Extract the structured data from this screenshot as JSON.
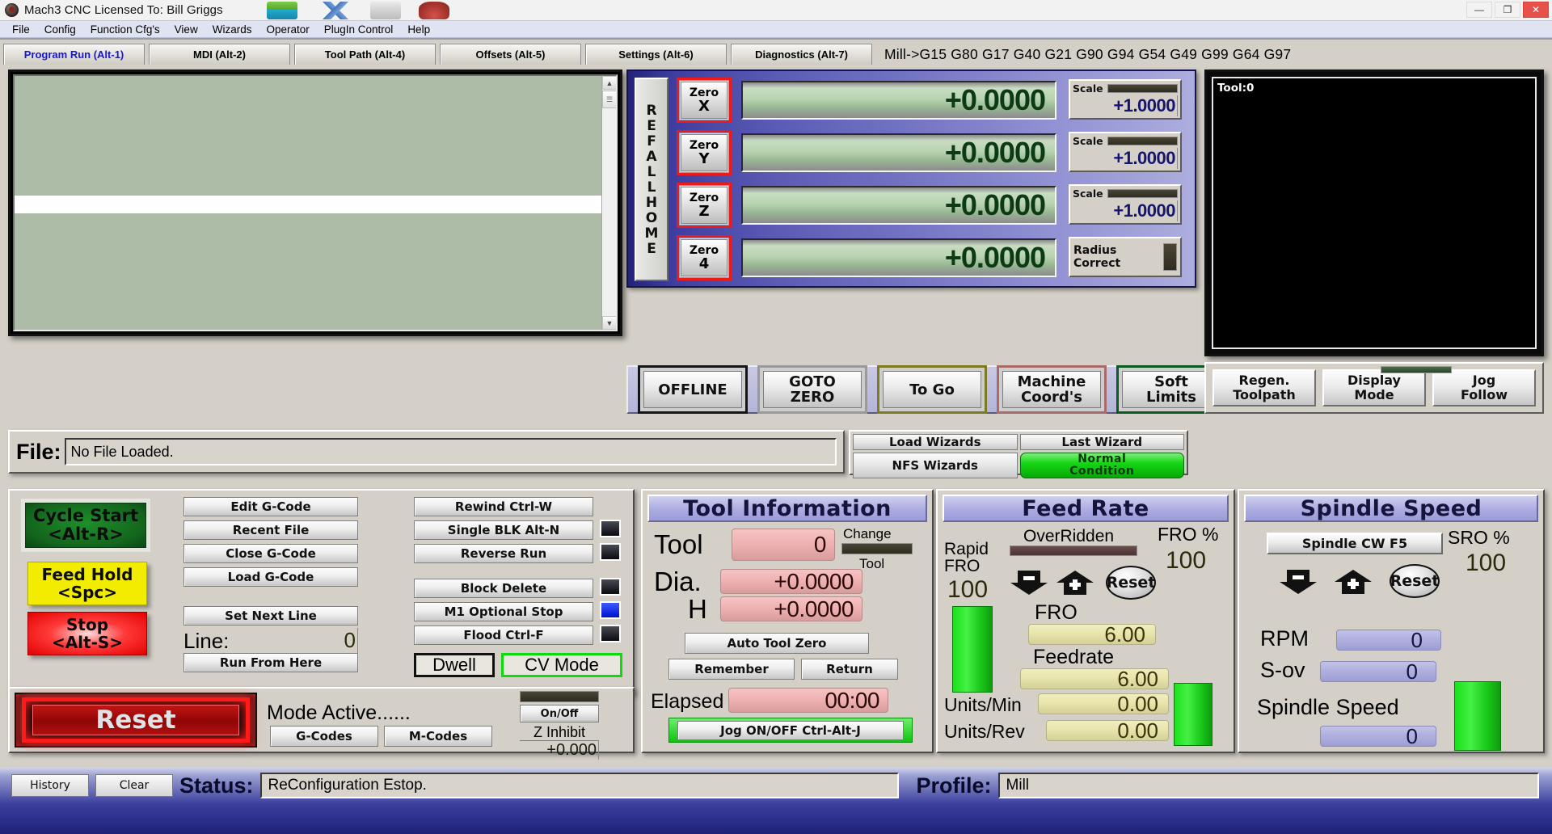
{
  "window": {
    "title": "Mach3 CNC  Licensed To: Bill Griggs",
    "minimize": "—",
    "maximize": "❐",
    "close": "✕"
  },
  "menu": [
    "File",
    "Config",
    "Function Cfg's",
    "View",
    "Wizards",
    "Operator",
    "PlugIn Control",
    "Help"
  ],
  "tabs": [
    {
      "label": "Program Run (Alt-1)",
      "active": true
    },
    {
      "label": "MDI (Alt-2)",
      "active": false
    },
    {
      "label": "Tool Path (Alt-4)",
      "active": false
    },
    {
      "label": "Offsets (Alt-5)",
      "active": false
    },
    {
      "label": "Settings (Alt-6)",
      "active": false
    },
    {
      "label": "Diagnostics (Alt-7)",
      "active": false
    }
  ],
  "gcode_status_line": "Mill->G15  G80 G17 G40 G21 G90 G94 G54 G49 G99 G64 G97",
  "ref_all_home": "REFALLHOME",
  "dro": {
    "axes": [
      {
        "zero_label_top": "Zero",
        "zero_label_bottom": "X",
        "value": "+0.0000",
        "scale_label": "Scale",
        "scale_value": "+1.0000"
      },
      {
        "zero_label_top": "Zero",
        "zero_label_bottom": "Y",
        "value": "+0.0000",
        "scale_label": "Scale",
        "scale_value": "+1.0000"
      },
      {
        "zero_label_top": "Zero",
        "zero_label_bottom": "Z",
        "value": "+0.0000",
        "scale_label": "Scale",
        "scale_value": "+1.0000"
      },
      {
        "zero_label_top": "Zero",
        "zero_label_bottom": "4",
        "value": "+0.0000",
        "scale_label": "Radius Correct",
        "scale_value": ""
      }
    ],
    "radius_correct_line1": "Radius",
    "radius_correct_line2": "Correct"
  },
  "mode_buttons": [
    {
      "line1": "OFFLINE",
      "line2": ""
    },
    {
      "line1": "GOTO",
      "line2": "ZERO"
    },
    {
      "line1": "To Go",
      "line2": ""
    },
    {
      "line1": "Machine",
      "line2": "Coord's"
    },
    {
      "line1": "Soft",
      "line2": "Limits"
    }
  ],
  "toolpath": {
    "overlay_label": "Tool:0",
    "buttons": [
      {
        "line1": "Regen.",
        "line2": "Toolpath"
      },
      {
        "line1": "Display",
        "line2": "Mode"
      },
      {
        "line1": "Jog",
        "line2": "Follow"
      }
    ]
  },
  "file": {
    "label": "File:",
    "value": "No File Loaded."
  },
  "wizards": {
    "load": "Load Wizards",
    "last": "Last Wizard",
    "nfs": "NFS Wizards",
    "condition_line1": "Normal",
    "condition_line2": "Condition"
  },
  "run_panel": {
    "cycle_start_line1": "Cycle Start",
    "cycle_start_line2": "<Alt-R>",
    "feed_hold_line1": "Feed Hold",
    "feed_hold_line2": "<Spc>",
    "stop_line1": "Stop",
    "stop_line2": "<Alt-S>",
    "col1": [
      "Edit G-Code",
      "Recent File",
      "Close G-Code",
      "Load G-Code"
    ],
    "set_next_line": "Set Next Line",
    "line_label": "Line:",
    "line_value": "0",
    "run_from_here": "Run From Here",
    "col2_top": [
      "Rewind Ctrl-W",
      "Single BLK Alt-N",
      "Reverse Run"
    ],
    "col2_bottom": [
      "Block Delete",
      "M1 Optional Stop",
      "Flood Ctrl-F"
    ],
    "dwell": "Dwell",
    "cv_mode": "CV Mode"
  },
  "reset_panel": {
    "reset": "Reset",
    "mode_active": "Mode Active......",
    "g_codes": "G-Codes",
    "m_codes": "M-Codes",
    "on_off": "On/Off",
    "z_inhibit": "Z Inhibit",
    "z_inhibit_value": "+0.000"
  },
  "tool_info": {
    "title": "Tool Information",
    "tool_label": "Tool",
    "tool_value": "0",
    "change_label": "Change",
    "change_sub": "Tool",
    "dia_label": "Dia.",
    "dia_value": "+0.0000",
    "h_label": "H",
    "h_value": "+0.0000",
    "auto_tool_zero": "Auto Tool Zero",
    "remember": "Remember",
    "return": "Return",
    "elapsed_label": "Elapsed",
    "elapsed_value": "00:00",
    "jog": "Jog ON/OFF Ctrl-Alt-J"
  },
  "feed_rate": {
    "title": "Feed Rate",
    "overridden": "OverRidden",
    "fro_pct_label": "FRO %",
    "fro_pct_value": "100",
    "rapid_label_l1": "Rapid",
    "rapid_label_l2": "FRO",
    "rapid_value": "100",
    "minus": "−",
    "plus": "+",
    "reset": "Reset",
    "fro_label": "FRO",
    "fro_value": "6.00",
    "feedrate_label": "Feedrate",
    "feedrate_value": "6.00",
    "units_min_label": "Units/Min",
    "units_min_value": "0.00",
    "units_rev_label": "Units/Rev",
    "units_rev_value": "0.00"
  },
  "spindle": {
    "title": "Spindle Speed",
    "cw_button": "Spindle CW F5",
    "sro_pct_label": "SRO %",
    "sro_pct_value": "100",
    "minus": "−",
    "plus": "+",
    "reset": "Reset",
    "rpm_label": "RPM",
    "rpm_value": "0",
    "sov_label": "S-ov",
    "sov_value": "0",
    "spindle_speed_label": "Spindle Speed",
    "spindle_speed_value": "0"
  },
  "status_bar": {
    "history": "History",
    "clear": "Clear",
    "status_label": "Status:",
    "status_value": "ReConfiguration Estop.",
    "profile_label": "Profile:",
    "profile_value": "Mill"
  },
  "colors": {
    "accent_blue": "#3b3f9e",
    "panel_bg": "#d4d0c8",
    "dro_green": "#b9d4b0",
    "estop_red": "#e40000",
    "ok_green": "#16d616"
  }
}
